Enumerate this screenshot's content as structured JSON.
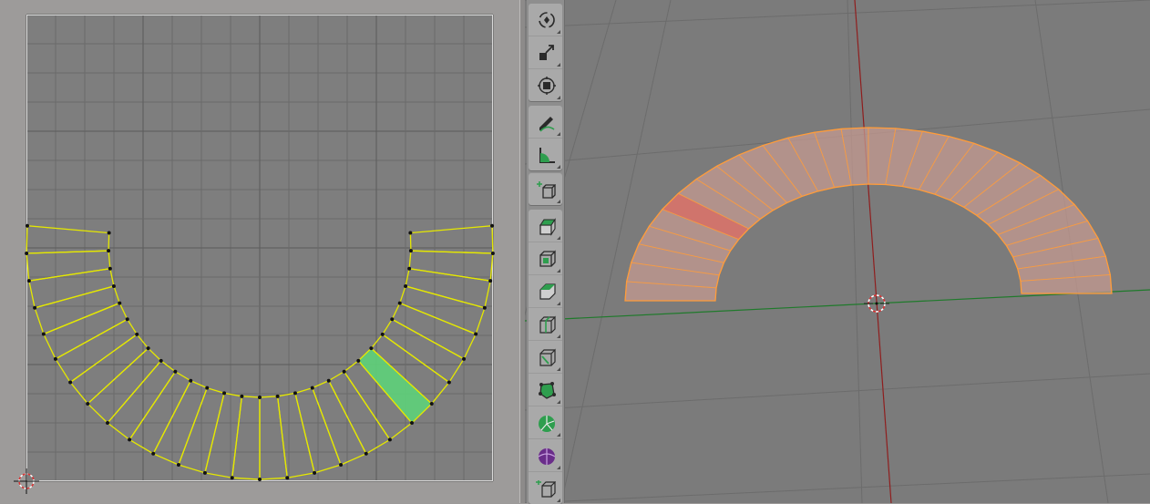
{
  "uv_editor": {
    "background": "#9d9b9a",
    "grid_fill": "#7e7e7e",
    "grid_line_color": "#6a6a6a",
    "grid_major_color": "#5b5b5b",
    "mesh_color": "#e5e800",
    "selected_face_color": "#5ed17a",
    "cursor_icon": "2d-cursor-icon"
  },
  "viewport": {
    "background": "#7b7b7b",
    "mesh_face_color": "#c49a90",
    "mesh_edge_color": "#ff9c3a",
    "selected_face_color": "#d9736a",
    "x_axis_color": "#1f7a2b",
    "y_axis_color": "#8f1e1e",
    "cursor_icon": "3d-cursor-icon"
  },
  "toolbar": {
    "groups": [
      [
        "rotate-tool-icon",
        "scale-tool-icon",
        "transform-tool-icon"
      ],
      [
        "annotate-tool-icon",
        "measure-tool-icon"
      ],
      [
        "add-cube-tool-icon"
      ],
      [
        "extrude-region-tool-icon",
        "inset-faces-tool-icon",
        "bevel-tool-icon",
        "loop-cut-tool-icon",
        "knife-tool-icon",
        "poly-build-tool-icon",
        "spin-tool-icon",
        "smooth-tool-icon",
        "shear-tool-icon"
      ]
    ]
  }
}
